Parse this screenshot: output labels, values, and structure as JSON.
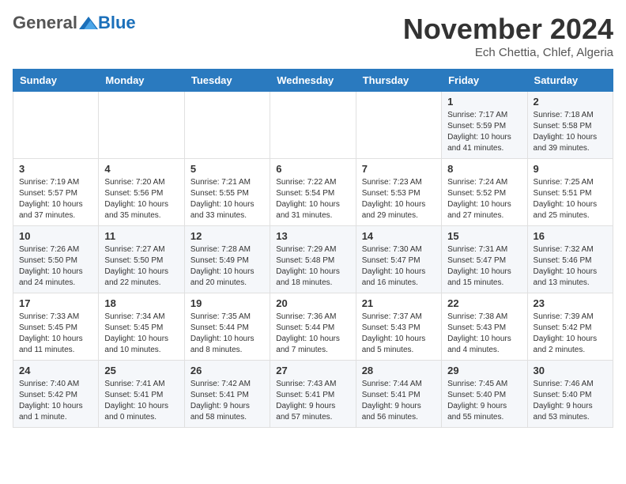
{
  "header": {
    "logo": {
      "general": "General",
      "blue": "Blue"
    },
    "title": "November 2024",
    "location": "Ech Chettia, Chlef, Algeria"
  },
  "calendar": {
    "columns": [
      "Sunday",
      "Monday",
      "Tuesday",
      "Wednesday",
      "Thursday",
      "Friday",
      "Saturday"
    ],
    "weeks": [
      [
        {
          "day": "",
          "info": ""
        },
        {
          "day": "",
          "info": ""
        },
        {
          "day": "",
          "info": ""
        },
        {
          "day": "",
          "info": ""
        },
        {
          "day": "",
          "info": ""
        },
        {
          "day": "1",
          "info": "Sunrise: 7:17 AM\nSunset: 5:59 PM\nDaylight: 10 hours and 41 minutes."
        },
        {
          "day": "2",
          "info": "Sunrise: 7:18 AM\nSunset: 5:58 PM\nDaylight: 10 hours and 39 minutes."
        }
      ],
      [
        {
          "day": "3",
          "info": "Sunrise: 7:19 AM\nSunset: 5:57 PM\nDaylight: 10 hours and 37 minutes."
        },
        {
          "day": "4",
          "info": "Sunrise: 7:20 AM\nSunset: 5:56 PM\nDaylight: 10 hours and 35 minutes."
        },
        {
          "day": "5",
          "info": "Sunrise: 7:21 AM\nSunset: 5:55 PM\nDaylight: 10 hours and 33 minutes."
        },
        {
          "day": "6",
          "info": "Sunrise: 7:22 AM\nSunset: 5:54 PM\nDaylight: 10 hours and 31 minutes."
        },
        {
          "day": "7",
          "info": "Sunrise: 7:23 AM\nSunset: 5:53 PM\nDaylight: 10 hours and 29 minutes."
        },
        {
          "day": "8",
          "info": "Sunrise: 7:24 AM\nSunset: 5:52 PM\nDaylight: 10 hours and 27 minutes."
        },
        {
          "day": "9",
          "info": "Sunrise: 7:25 AM\nSunset: 5:51 PM\nDaylight: 10 hours and 25 minutes."
        }
      ],
      [
        {
          "day": "10",
          "info": "Sunrise: 7:26 AM\nSunset: 5:50 PM\nDaylight: 10 hours and 24 minutes."
        },
        {
          "day": "11",
          "info": "Sunrise: 7:27 AM\nSunset: 5:50 PM\nDaylight: 10 hours and 22 minutes."
        },
        {
          "day": "12",
          "info": "Sunrise: 7:28 AM\nSunset: 5:49 PM\nDaylight: 10 hours and 20 minutes."
        },
        {
          "day": "13",
          "info": "Sunrise: 7:29 AM\nSunset: 5:48 PM\nDaylight: 10 hours and 18 minutes."
        },
        {
          "day": "14",
          "info": "Sunrise: 7:30 AM\nSunset: 5:47 PM\nDaylight: 10 hours and 16 minutes."
        },
        {
          "day": "15",
          "info": "Sunrise: 7:31 AM\nSunset: 5:47 PM\nDaylight: 10 hours and 15 minutes."
        },
        {
          "day": "16",
          "info": "Sunrise: 7:32 AM\nSunset: 5:46 PM\nDaylight: 10 hours and 13 minutes."
        }
      ],
      [
        {
          "day": "17",
          "info": "Sunrise: 7:33 AM\nSunset: 5:45 PM\nDaylight: 10 hours and 11 minutes."
        },
        {
          "day": "18",
          "info": "Sunrise: 7:34 AM\nSunset: 5:45 PM\nDaylight: 10 hours and 10 minutes."
        },
        {
          "day": "19",
          "info": "Sunrise: 7:35 AM\nSunset: 5:44 PM\nDaylight: 10 hours and 8 minutes."
        },
        {
          "day": "20",
          "info": "Sunrise: 7:36 AM\nSunset: 5:44 PM\nDaylight: 10 hours and 7 minutes."
        },
        {
          "day": "21",
          "info": "Sunrise: 7:37 AM\nSunset: 5:43 PM\nDaylight: 10 hours and 5 minutes."
        },
        {
          "day": "22",
          "info": "Sunrise: 7:38 AM\nSunset: 5:43 PM\nDaylight: 10 hours and 4 minutes."
        },
        {
          "day": "23",
          "info": "Sunrise: 7:39 AM\nSunset: 5:42 PM\nDaylight: 10 hours and 2 minutes."
        }
      ],
      [
        {
          "day": "24",
          "info": "Sunrise: 7:40 AM\nSunset: 5:42 PM\nDaylight: 10 hours and 1 minute."
        },
        {
          "day": "25",
          "info": "Sunrise: 7:41 AM\nSunset: 5:41 PM\nDaylight: 10 hours and 0 minutes."
        },
        {
          "day": "26",
          "info": "Sunrise: 7:42 AM\nSunset: 5:41 PM\nDaylight: 9 hours and 58 minutes."
        },
        {
          "day": "27",
          "info": "Sunrise: 7:43 AM\nSunset: 5:41 PM\nDaylight: 9 hours and 57 minutes."
        },
        {
          "day": "28",
          "info": "Sunrise: 7:44 AM\nSunset: 5:41 PM\nDaylight: 9 hours and 56 minutes."
        },
        {
          "day": "29",
          "info": "Sunrise: 7:45 AM\nSunset: 5:40 PM\nDaylight: 9 hours and 55 minutes."
        },
        {
          "day": "30",
          "info": "Sunrise: 7:46 AM\nSunset: 5:40 PM\nDaylight: 9 hours and 53 minutes."
        }
      ]
    ]
  }
}
